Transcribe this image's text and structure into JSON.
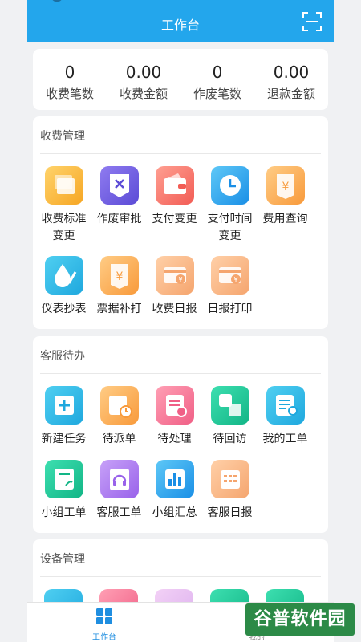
{
  "header": {
    "title": "工作台"
  },
  "stats": [
    {
      "value": "0",
      "label": "收费笔数"
    },
    {
      "value": "0.00",
      "label": "收费金额"
    },
    {
      "value": "0",
      "label": "作废笔数"
    },
    {
      "value": "0.00",
      "label": "退款金额"
    }
  ],
  "sections": {
    "fee": {
      "title": "收费管理",
      "items": [
        {
          "label": "收费标准变更",
          "icon": "cards-icon"
        },
        {
          "label": "作废审批",
          "icon": "void-document-icon"
        },
        {
          "label": "支付变更",
          "icon": "wallet-icon"
        },
        {
          "label": "支付时间变更",
          "icon": "clock-icon"
        },
        {
          "label": "费用查询",
          "icon": "yen-ticket-icon"
        },
        {
          "label": "仪表抄表",
          "icon": "water-drop-icon"
        },
        {
          "label": "票据补打",
          "icon": "yen-ticket-icon"
        },
        {
          "label": "收费日报",
          "icon": "yen-card-icon"
        },
        {
          "label": "日报打印",
          "icon": "yen-card-icon"
        }
      ]
    },
    "service": {
      "title": "客服待办",
      "items": [
        {
          "label": "新建任务",
          "icon": "plus-icon"
        },
        {
          "label": "待派单",
          "icon": "calendar-clock-icon"
        },
        {
          "label": "待处理",
          "icon": "clipboard-alert-icon"
        },
        {
          "label": "待回访",
          "icon": "linked-squares-icon"
        },
        {
          "label": "我的工单",
          "icon": "document-user-icon"
        },
        {
          "label": "小组工单",
          "icon": "notebook-icon"
        },
        {
          "label": "客服工单",
          "icon": "headset-icon"
        },
        {
          "label": "小组汇总",
          "icon": "bar-chart-icon"
        },
        {
          "label": "客服日报",
          "icon": "calendar-grid-icon"
        }
      ]
    },
    "device": {
      "title": "设备管理"
    }
  },
  "tabbar": {
    "workbench": "工作台",
    "mine": "我的"
  },
  "watermark": "谷普软件园",
  "colors": {
    "header": "#23a6ec",
    "active_tab": "#1f8ee0",
    "watermark_bg": "#2c8a47"
  }
}
